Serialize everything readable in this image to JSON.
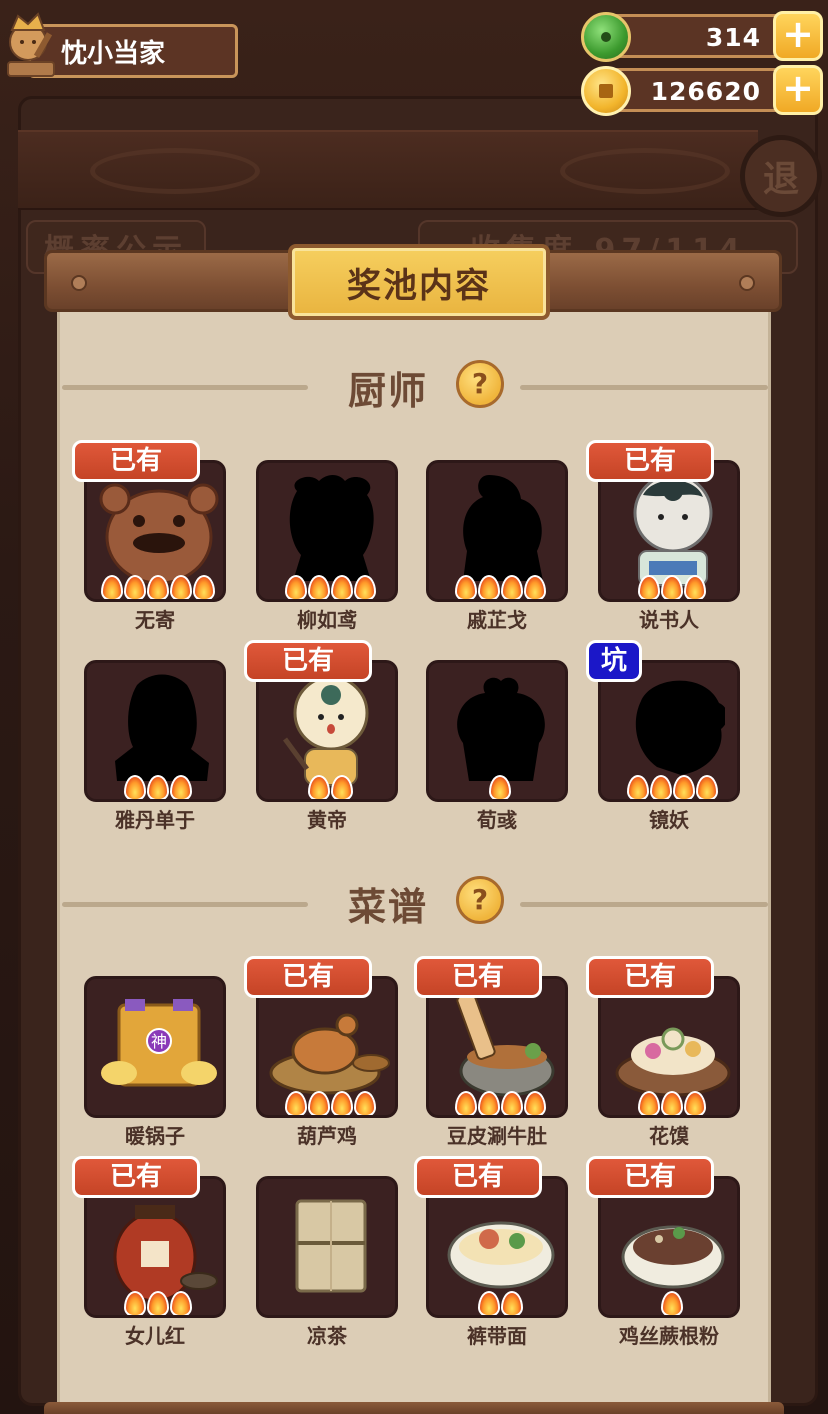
{
  "player": {
    "name": "忱小当家"
  },
  "currencies": [
    {
      "id": "jade",
      "value": "314",
      "icon": "jade-coin-icon"
    },
    {
      "id": "gold",
      "value": "126620",
      "icon": "gold-coin-icon"
    }
  ],
  "dialog": {
    "title": "奖池内容"
  },
  "sections": {
    "chefs": {
      "title": "厨师",
      "help": "?"
    },
    "recipes": {
      "title": "菜谱",
      "help": "?"
    }
  },
  "badges": {
    "owned": "已有",
    "special": "坑"
  },
  "chefs": [
    {
      "name": "无寄",
      "owned": true,
      "stars": 5,
      "revealed": true
    },
    {
      "name": "柳如鸢",
      "owned": false,
      "stars": 4,
      "revealed": false
    },
    {
      "name": "戚芷戈",
      "owned": false,
      "stars": 4,
      "revealed": false
    },
    {
      "name": "说书人",
      "owned": true,
      "stars": 3,
      "revealed": true
    },
    {
      "name": "雅丹单于",
      "owned": false,
      "stars": 3,
      "revealed": false
    },
    {
      "name": "黄帝",
      "owned": true,
      "stars": 2,
      "revealed": true
    },
    {
      "name": "荀彧",
      "owned": false,
      "stars": 1,
      "revealed": false
    },
    {
      "name": "镜妖",
      "owned": false,
      "special": true,
      "stars": 4,
      "revealed": false
    }
  ],
  "recipes": [
    {
      "name": "暖锅子",
      "owned": false,
      "stars": 0,
      "tag": "神"
    },
    {
      "name": "葫芦鸡",
      "owned": true,
      "stars": 4
    },
    {
      "name": "豆皮涮牛肚",
      "owned": true,
      "stars": 4
    },
    {
      "name": "花馍",
      "owned": true,
      "stars": 3
    },
    {
      "name": "女儿红",
      "owned": true,
      "stars": 3
    },
    {
      "name": "凉茶",
      "owned": false,
      "stars": 0
    },
    {
      "name": "裤带面",
      "owned": true,
      "stars": 2
    },
    {
      "name": "鸡丝蕨根粉",
      "owned": true,
      "stars": 1
    }
  ],
  "background": {
    "back_button": "退",
    "tab_left": "概率公示",
    "tab_right": "收集度 97/114"
  }
}
